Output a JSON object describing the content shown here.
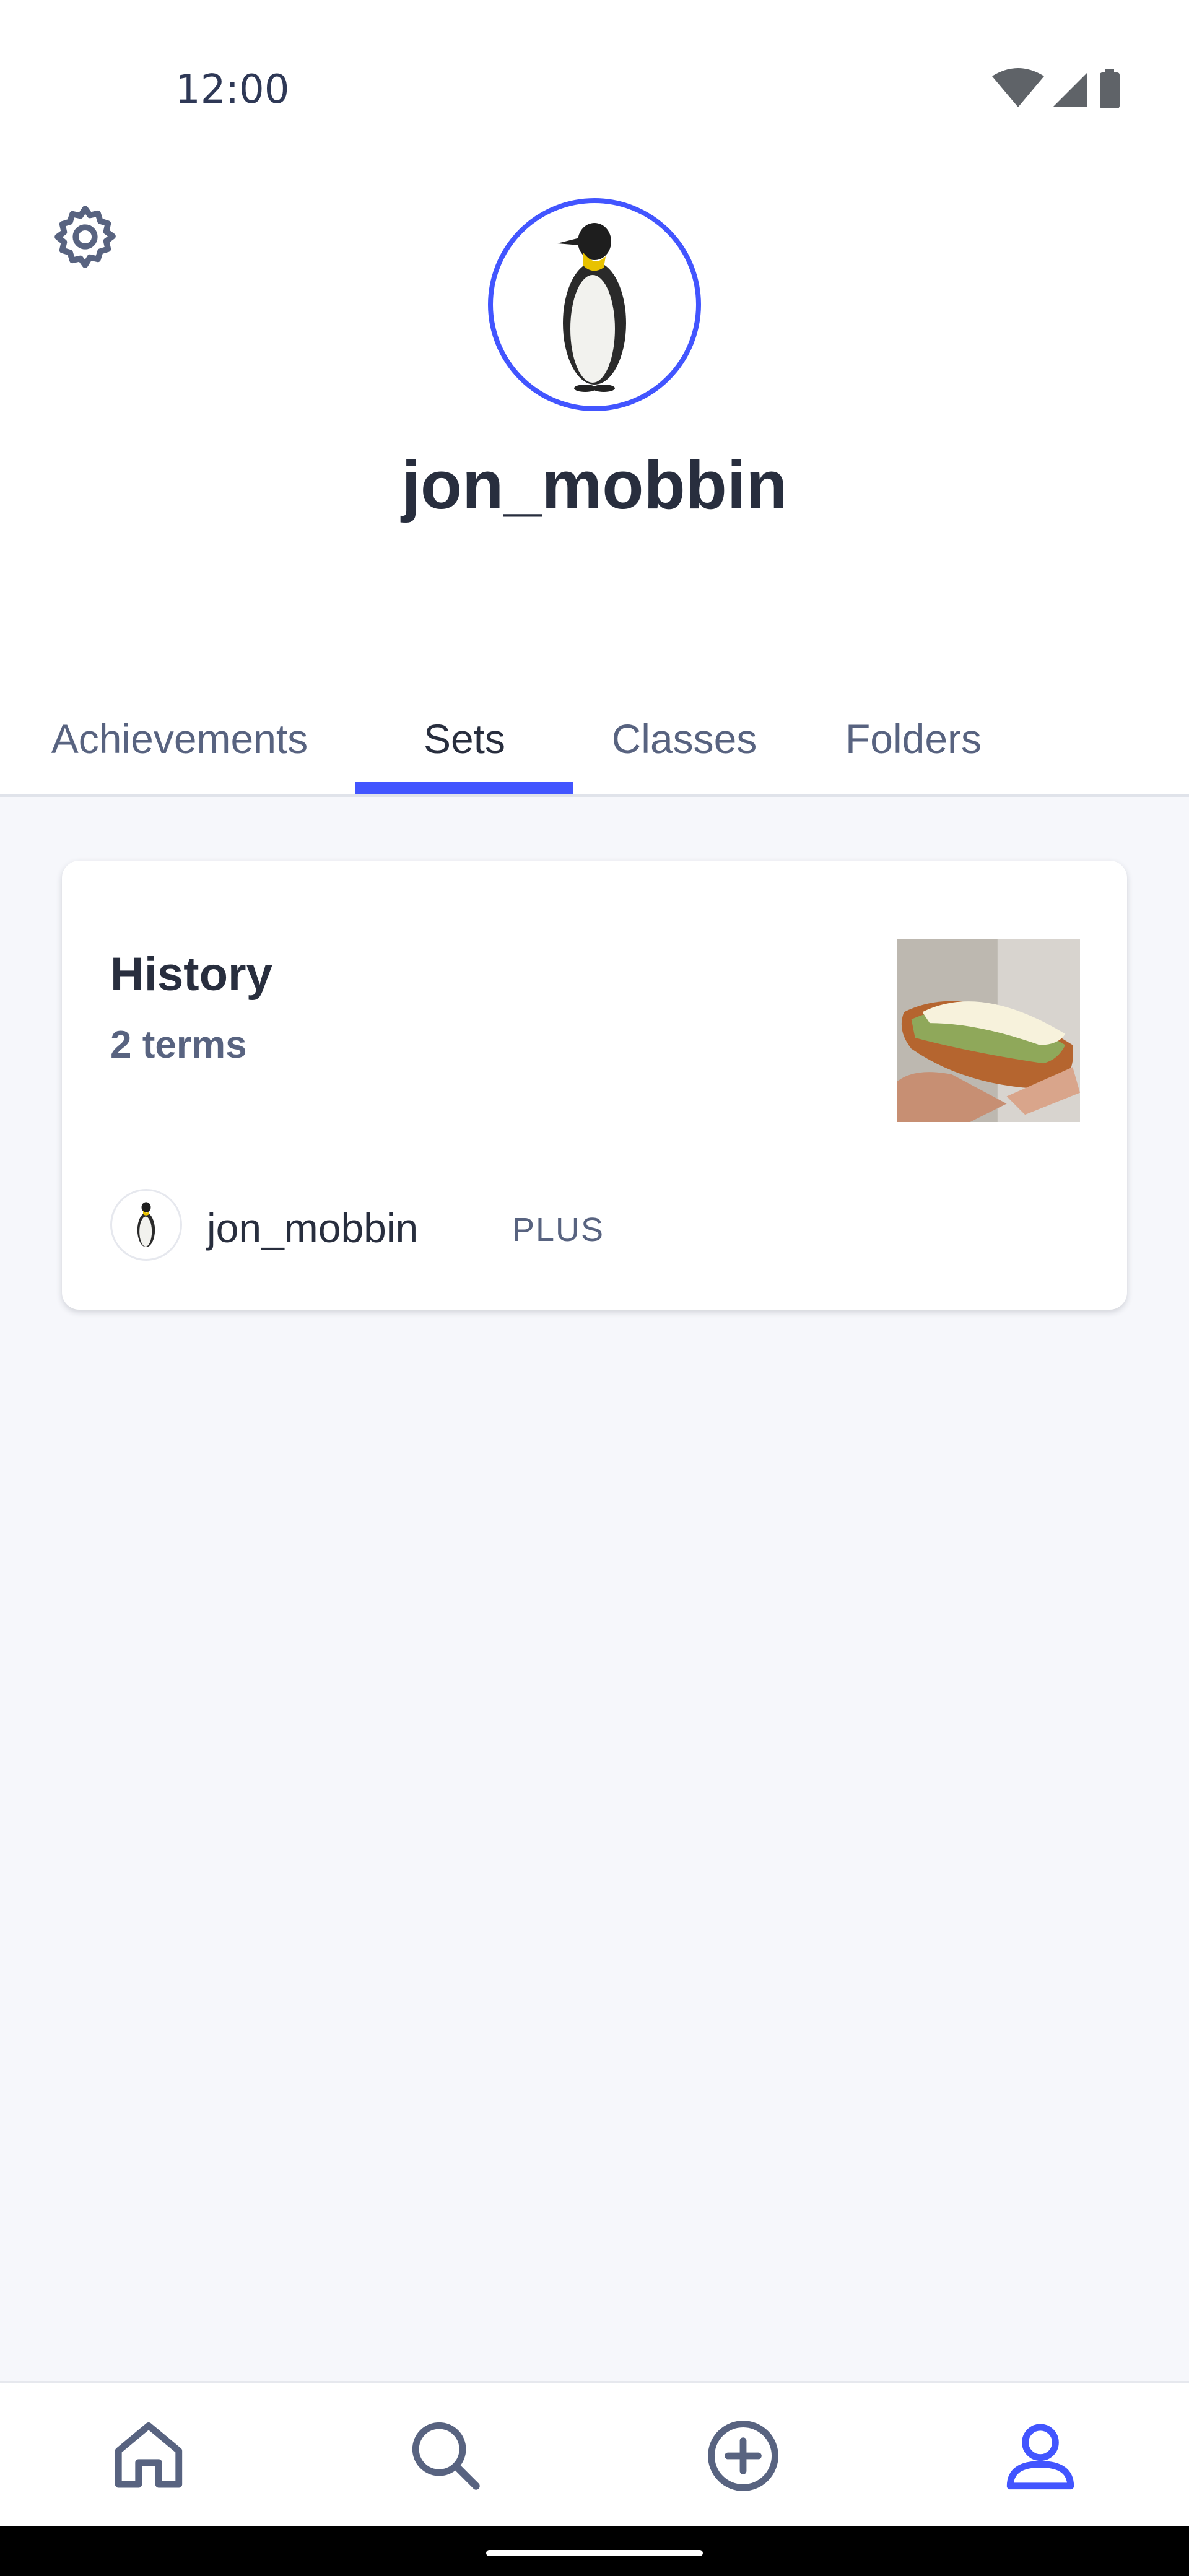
{
  "status_bar": {
    "time": "12:00",
    "icons": [
      "wifi-icon",
      "cellular-icon",
      "battery-icon"
    ]
  },
  "profile": {
    "username": "jon_mobbin",
    "avatar_icon": "penguin-avatar",
    "settings_icon": "gear-icon"
  },
  "tabs": [
    {
      "label": "Achievements",
      "active": false
    },
    {
      "label": "Sets",
      "active": true
    },
    {
      "label": "Classes",
      "active": false
    },
    {
      "label": "Folders",
      "active": false
    }
  ],
  "sets": [
    {
      "title": "History",
      "terms": "2 terms",
      "thumbnail_icon": "hotdog-image",
      "owner": {
        "name": "jon_mobbin",
        "badge": "PLUS"
      }
    }
  ],
  "bottom_nav": [
    {
      "icon": "home-icon",
      "active": false
    },
    {
      "icon": "search-icon",
      "active": false
    },
    {
      "icon": "add-circle-icon",
      "active": false
    },
    {
      "icon": "profile-icon",
      "active": true
    }
  ],
  "colors": {
    "accent": "#4255ff",
    "text_primary": "#282e3e",
    "text_secondary": "#586380",
    "background": "#f6f7fb"
  }
}
